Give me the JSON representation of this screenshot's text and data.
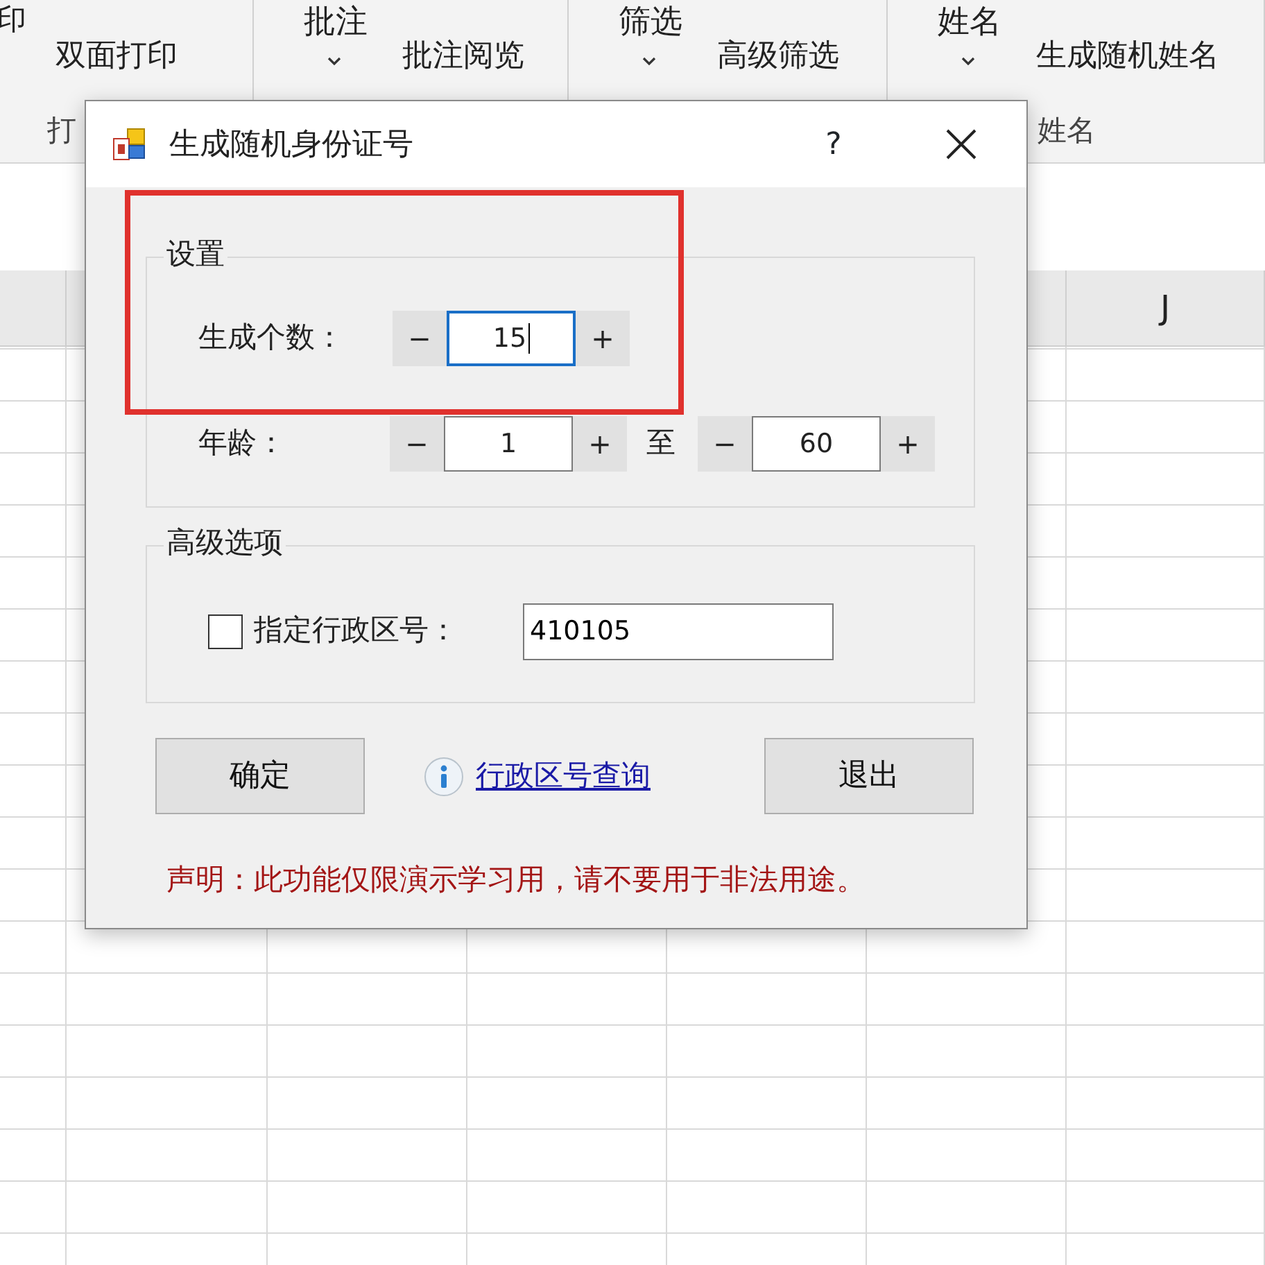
{
  "ribbon": {
    "groups": [
      {
        "label": "打",
        "items": [
          {
            "kind": "upper",
            "label": "印"
          },
          {
            "kind": "lower",
            "label": "双面打印"
          }
        ]
      },
      {
        "items": [
          {
            "kind": "dropdown",
            "label": "批注"
          },
          {
            "kind": "lower",
            "label": "批注阅览"
          }
        ]
      },
      {
        "items": [
          {
            "kind": "dropdown",
            "label": "筛选"
          },
          {
            "kind": "lower",
            "label": "高级筛选"
          }
        ]
      },
      {
        "label": "姓名",
        "items": [
          {
            "kind": "dropdown",
            "label": "姓名"
          },
          {
            "kind": "lower",
            "label": "生成随机姓名"
          }
        ]
      }
    ]
  },
  "sheet": {
    "columns": [
      {
        "header": "J"
      }
    ]
  },
  "dialog": {
    "title": "生成随机身份证号",
    "help": "?",
    "settings": {
      "legend": "设置",
      "count": {
        "label": "生成个数：",
        "minus": "−",
        "value": "15",
        "plus": "+",
        "focused": true
      },
      "age": {
        "label": "年龄：",
        "from": {
          "minus": "−",
          "value": "1",
          "plus": "+",
          "focused": false
        },
        "to_label": "至",
        "to": {
          "minus": "−",
          "value": "60",
          "plus": "+",
          "focused": false
        }
      }
    },
    "advanced": {
      "legend": "高级选项",
      "region_code": {
        "label": "指定行政区号：",
        "checked": false,
        "value": "410105"
      }
    },
    "buttons": [
      {
        "label": "确定"
      },
      {
        "label": "退出"
      }
    ],
    "link": "行政区号查询",
    "disclaimer": "声明：此功能仅限演示学习用，请不要用于非法用途。"
  },
  "annotation": {
    "kind": "rectangle"
  }
}
